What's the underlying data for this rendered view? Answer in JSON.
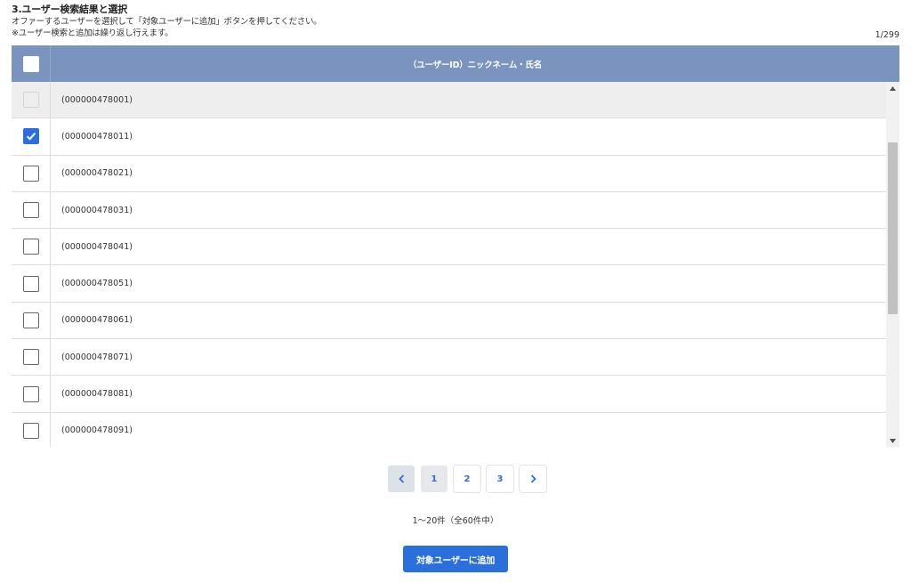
{
  "section": {
    "title": "3.ユーザー検索結果と選択",
    "desc1": "オファーするユーザーを選択して「対象ユーザーに追加」ボタンを押してください。",
    "desc2": "※ユーザー検索と追加は繰り返し行えます。",
    "count": "1/299"
  },
  "table": {
    "header_label": "（ユーザーID）ニックネーム・氏名",
    "rows": [
      {
        "id": "(000000478001)",
        "state": "disabled"
      },
      {
        "id": "(000000478011)",
        "state": "checked"
      },
      {
        "id": "(000000478021)",
        "state": "unchecked"
      },
      {
        "id": "(000000478031)",
        "state": "unchecked"
      },
      {
        "id": "(000000478041)",
        "state": "unchecked"
      },
      {
        "id": "(000000478051)",
        "state": "unchecked"
      },
      {
        "id": "(000000478061)",
        "state": "unchecked"
      },
      {
        "id": "(000000478071)",
        "state": "unchecked"
      },
      {
        "id": "(000000478081)",
        "state": "unchecked"
      },
      {
        "id": "(000000478091)",
        "state": "unchecked"
      }
    ]
  },
  "pagination": {
    "prev_icon": "chevron-left-icon",
    "next_icon": "chevron-right-icon",
    "pages": [
      "1",
      "2",
      "3"
    ],
    "current": "1",
    "range_text": "1〜20件（全60件中）"
  },
  "actions": {
    "add_label": "対象ユーザーに追加"
  },
  "colors": {
    "header_bg": "#7b93bf",
    "accent": "#2a6fdb",
    "disabled_row": "#eeeeee"
  }
}
